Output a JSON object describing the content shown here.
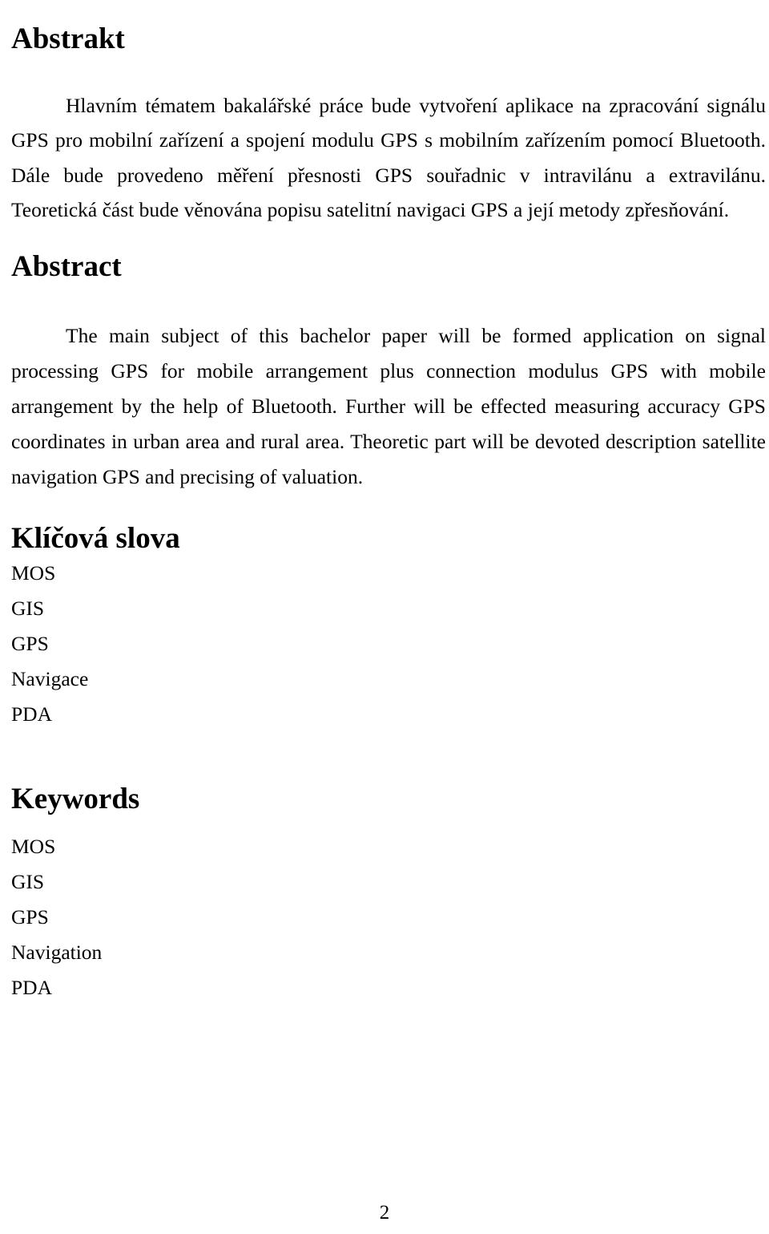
{
  "document": {
    "page_number": "2",
    "background_color": "#ffffff",
    "text_color": "#000000"
  },
  "sections": {
    "abstrakt": {
      "heading": "Abstrakt",
      "paragraph": "Hlavním tématem bakalářské práce bude vytvoření aplikace na zpracování signálu GPS pro mobilní zařízení a spojení modulu GPS s mobilním zařízením pomocí Bluetooth. Dále bude provedeno měření přesnosti GPS souřadnic v intravilánu a extravilánu. Teoretická část bude věnována popisu satelitní navigaci GPS a její metody zpřesňování."
    },
    "abstract": {
      "heading": "Abstract",
      "paragraph": "The main subject of this bachelor paper will be formed application on signal processing GPS for mobile arrangement plus connection modulus GPS with mobile arrangement by the help of Bluetooth. Further will be effected measuring accuracy GPS coordinates in urban area and rural area. Theoretic part will be devoted description satellite navigation GPS and precising of valuation."
    },
    "klicova_slova": {
      "heading": "Klíčová slova",
      "items": [
        "MOS",
        "GIS",
        "GPS",
        "Navigace",
        "PDA"
      ]
    },
    "keywords": {
      "heading": "Keywords",
      "items": [
        "MOS",
        "GIS",
        "GPS",
        "Navigation",
        "PDA"
      ]
    }
  }
}
